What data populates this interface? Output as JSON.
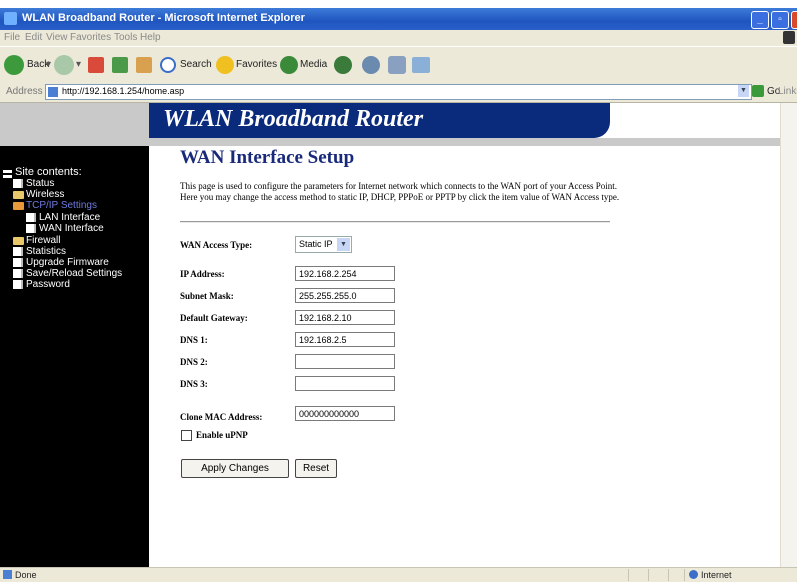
{
  "window": {
    "title": "WLAN Broadband Router - Microsoft Internet Explorer"
  },
  "menubar": {
    "items": [
      "File",
      "Edit",
      "View",
      "Favorites",
      "Tools",
      "Help"
    ]
  },
  "toolbar": {
    "back_label": "Back",
    "search_label": "Search",
    "favorites_label": "Favorites",
    "media_label": "Media"
  },
  "addressbar": {
    "label": "Address",
    "url": "http://192.168.1.254/home.asp",
    "go_label": "Go",
    "links_label": "Links"
  },
  "banner": {
    "title": "WLAN Broadband Router"
  },
  "sidebar": {
    "root": "Site contents:",
    "items": [
      "Status",
      "Wireless",
      "TCP/IP Settings",
      "LAN Interface",
      "WAN Interface",
      "Firewall",
      "Statistics",
      "Upgrade Firmware",
      "Save/Reload Settings",
      "Password"
    ]
  },
  "main": {
    "heading": "WAN Interface Setup",
    "description": "This page is used to configure the parameters for Internet network which connects to the WAN port of your Access Point. Here you may change the access method to static IP, DHCP, PPPoE or PPTP by click the item value of WAN Access type.",
    "access_type_label": "WAN Access Type:",
    "access_type_value": "Static IP",
    "fields": [
      {
        "label": "IP Address:",
        "value": "192.168.2.254"
      },
      {
        "label": "Subnet Mask:",
        "value": "255.255.255.0"
      },
      {
        "label": "Default Gateway:",
        "value": "192.168.2.10"
      },
      {
        "label": "DNS 1:",
        "value": "192.168.2.5"
      },
      {
        "label": "DNS 2:",
        "value": ""
      },
      {
        "label": "DNS 3:",
        "value": ""
      }
    ],
    "clone_mac": {
      "label": "Clone MAC Address:",
      "value": "000000000000"
    },
    "upnp_label": "Enable uPNP",
    "upnp_checked": false,
    "apply_label": "Apply Changes",
    "reset_label": "Reset"
  },
  "statusbar": {
    "text": "Done",
    "zone": "Internet"
  },
  "colors": {
    "banner": "#0a2a7c",
    "heading": "#1a2a7a",
    "sidebar": "#000000",
    "titlebar": "#2a5fc9"
  }
}
